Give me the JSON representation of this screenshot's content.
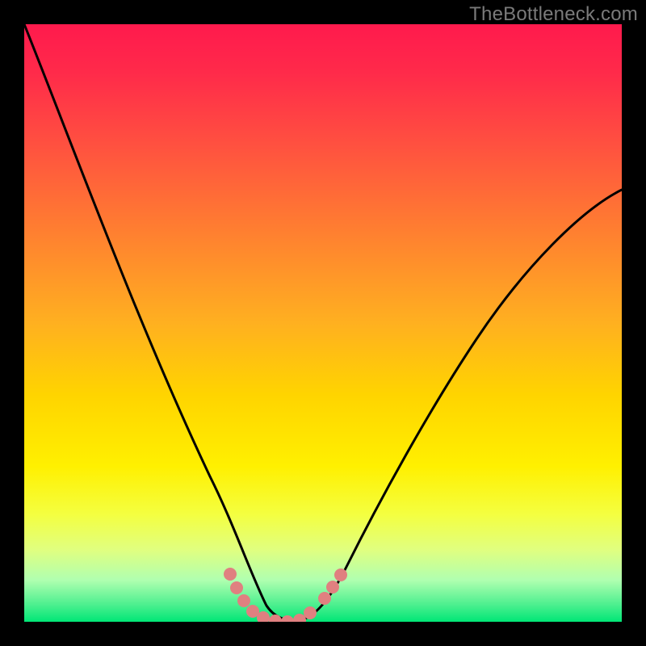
{
  "watermark": "TheBottleneck.com",
  "chart_data": {
    "type": "line",
    "title": "",
    "xlabel": "",
    "ylabel": "",
    "xlim": [
      0,
      100
    ],
    "ylim": [
      0,
      100
    ],
    "series": [
      {
        "name": "curve",
        "x": [
          0,
          5,
          10,
          15,
          20,
          25,
          28,
          30,
          32,
          34,
          36,
          38,
          40,
          42,
          44,
          46,
          48,
          50,
          55,
          60,
          65,
          70,
          75,
          80,
          85,
          90,
          95,
          100
        ],
        "y": [
          100,
          84,
          69,
          55,
          42,
          29,
          22,
          17,
          13,
          9,
          5,
          2,
          0.5,
          0,
          0,
          0.5,
          2,
          5,
          14,
          24,
          34,
          43,
          51,
          58,
          64,
          68,
          72,
          74
        ]
      },
      {
        "name": "markers",
        "x": [
          34.5,
          36,
          37.5,
          39,
          40.5,
          42,
          43.5,
          45,
          46.5,
          48.5,
          50,
          51.5
        ],
        "y": [
          8,
          5,
          3,
          1.5,
          0.5,
          0,
          0,
          0.3,
          1.5,
          3.5,
          5.5,
          8
        ]
      }
    ],
    "colors": {
      "curve": "#000000",
      "markers": "#e08080",
      "gradient_top": "#ff1a4d",
      "gradient_mid": "#ffd900",
      "gradient_low": "#e6ff66",
      "gradient_bottom": "#00e676"
    }
  }
}
